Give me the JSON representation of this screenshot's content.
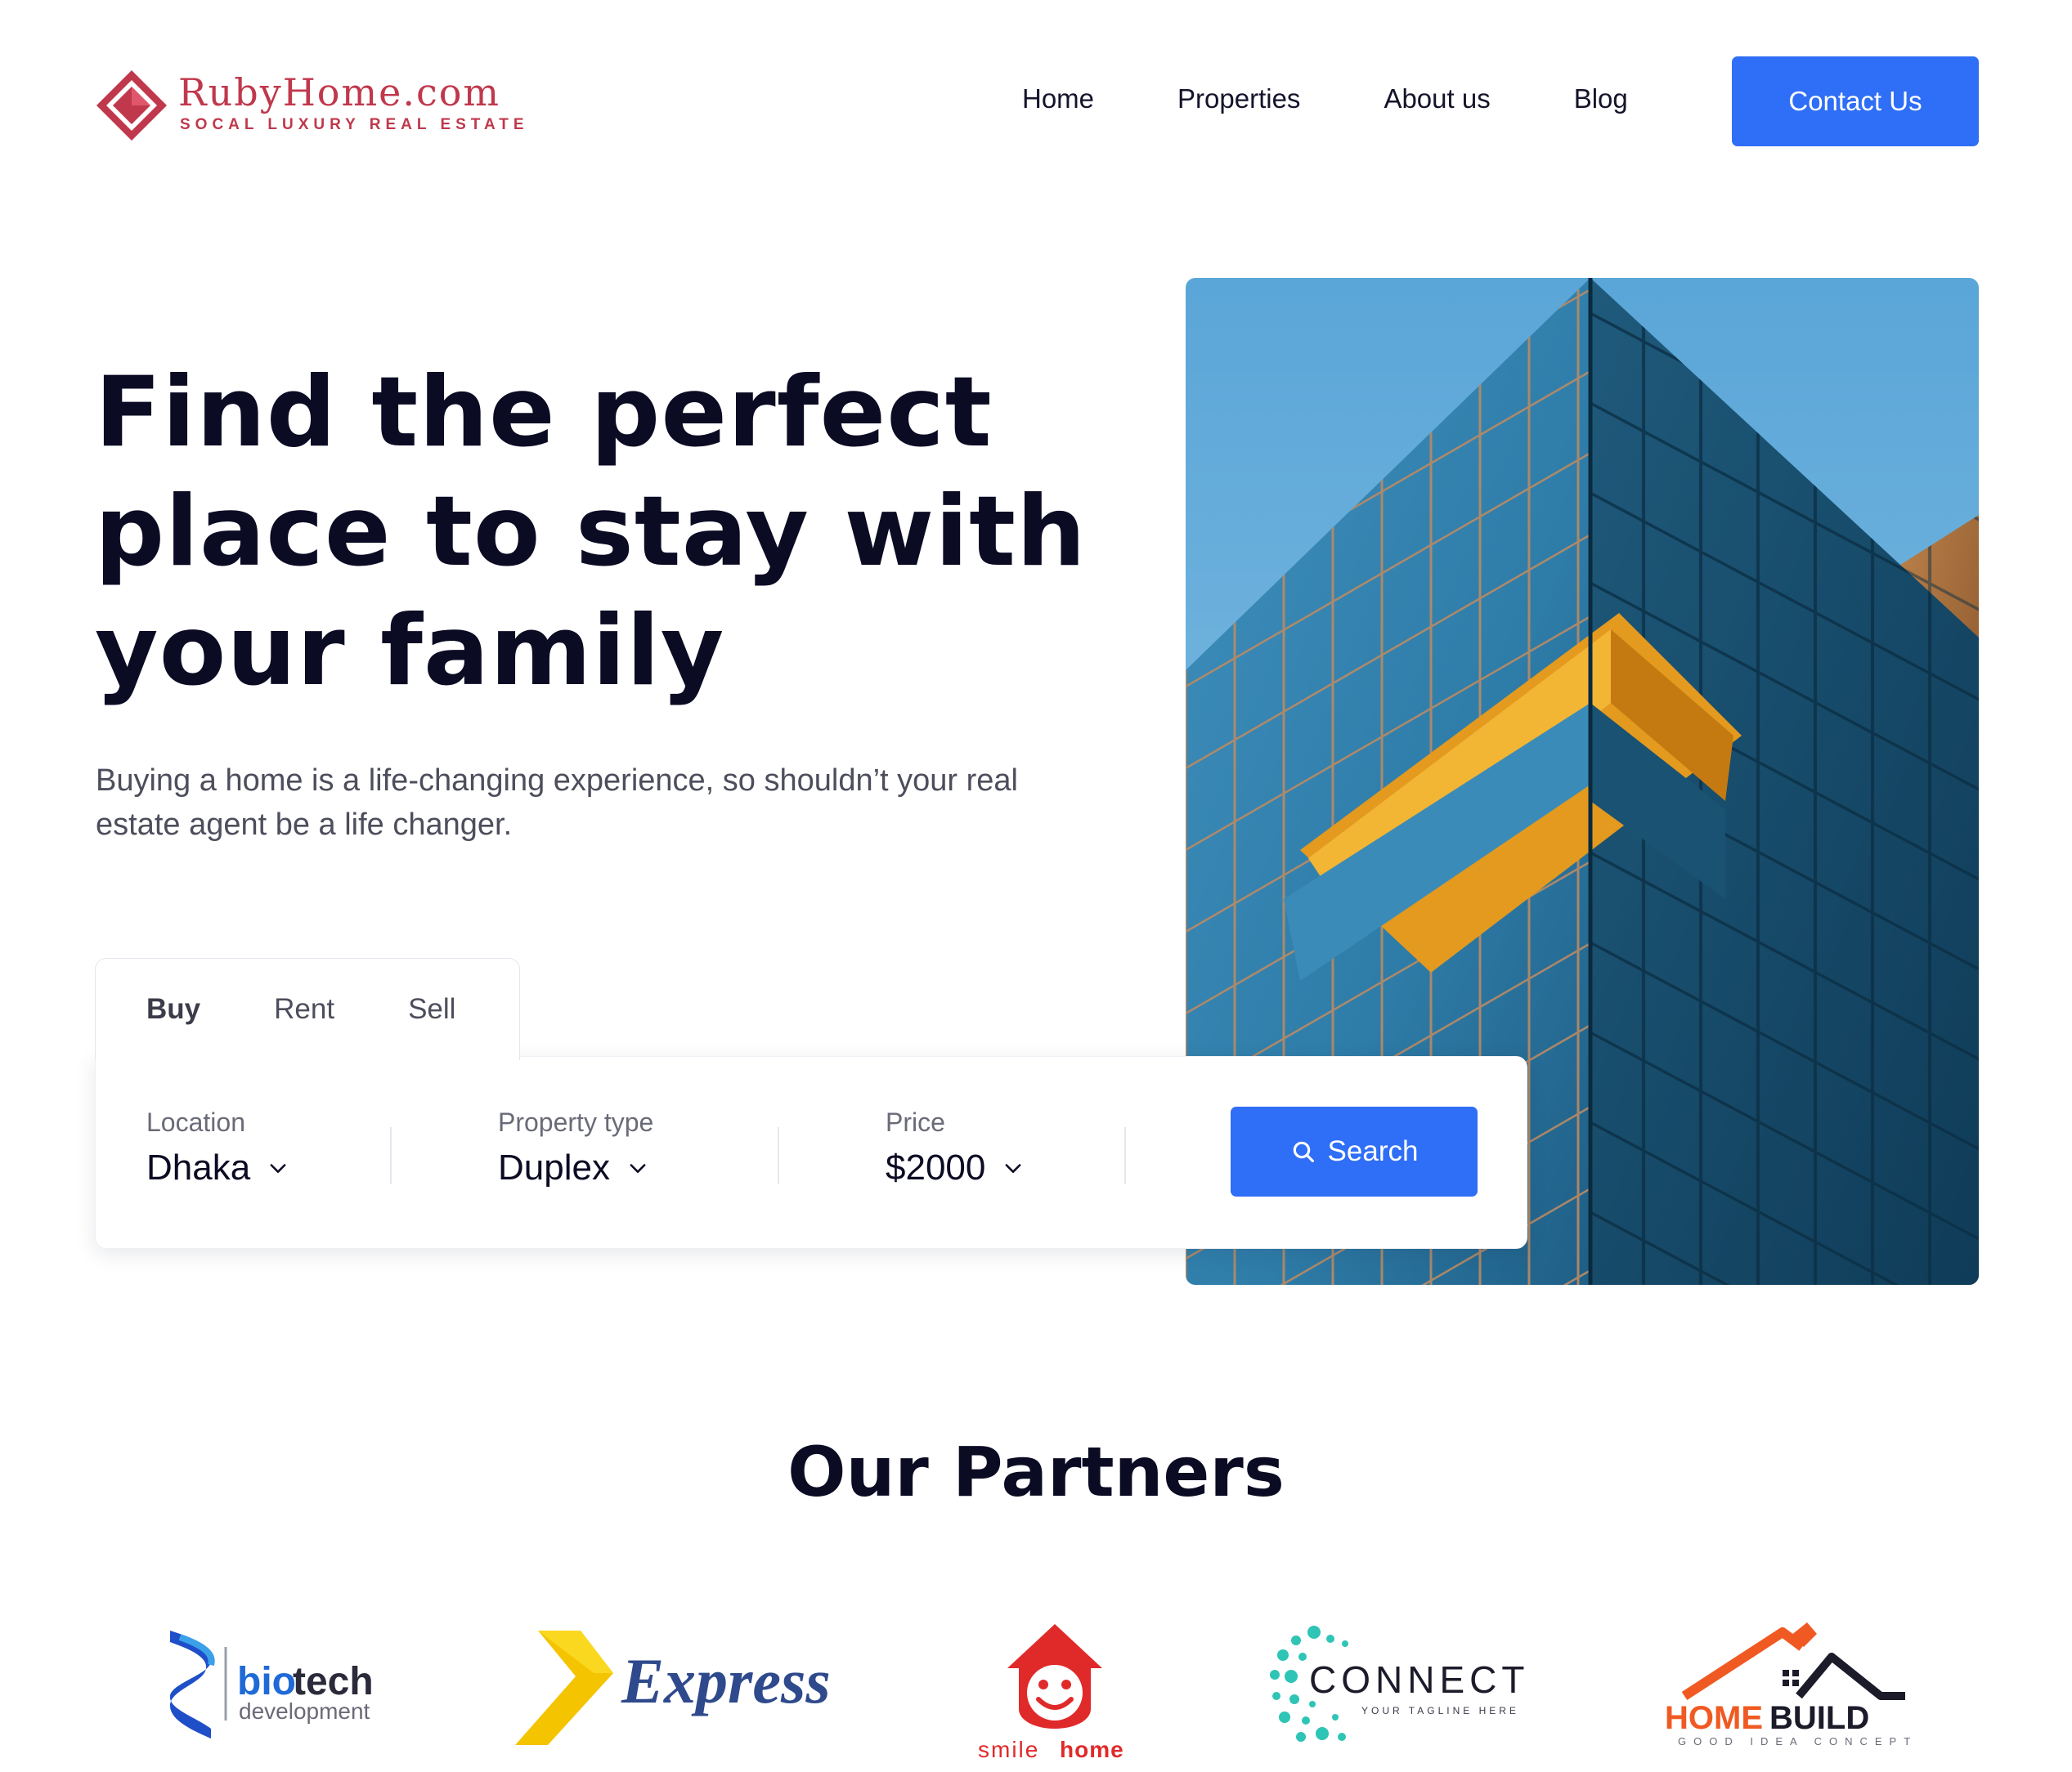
{
  "brand": {
    "name": "RubyHome.com",
    "name_display": "RubyHome.com",
    "tagline": "SOCAL LUXURY REAL ESTATE",
    "color": "#c0384c"
  },
  "nav": {
    "items": [
      "Home",
      "Properties",
      "About us",
      "Blog"
    ],
    "contact_label": "Contact Us",
    "accent": "#2f6ef6"
  },
  "hero": {
    "title": "Find the perfect place to stay with your family",
    "subtitle": "Buying a home is a life-changing experience, so shouldn’t your real estate agent be a life changer."
  },
  "search": {
    "tabs": [
      "Buy",
      "Rent",
      "Sell"
    ],
    "active_tab": "Buy",
    "fields": [
      {
        "label": "Location",
        "value": "Dhaka"
      },
      {
        "label": "Property type",
        "value": "Duplex"
      },
      {
        "label": "Price",
        "value": "$2000"
      }
    ],
    "button_label": "Search",
    "button_icon": "search-icon"
  },
  "partners": {
    "title": "Our Partners",
    "logos": [
      {
        "name": "biotech development",
        "text_main_a": "bio",
        "text_main_b": "tech",
        "text_sub": "development"
      },
      {
        "name": "Express",
        "text_main": "Express"
      },
      {
        "name": "smilehome",
        "text_a": "smile",
        "text_b": "home"
      },
      {
        "name": "CONNECT",
        "text_main": "CONNECT",
        "text_sub": "YOUR TAGLINE HERE"
      },
      {
        "name": "HOMEBUILD",
        "text_a": "HOME",
        "text_b": "BUILD",
        "text_sub": "GOOD IDEA CONCEPT"
      }
    ]
  }
}
